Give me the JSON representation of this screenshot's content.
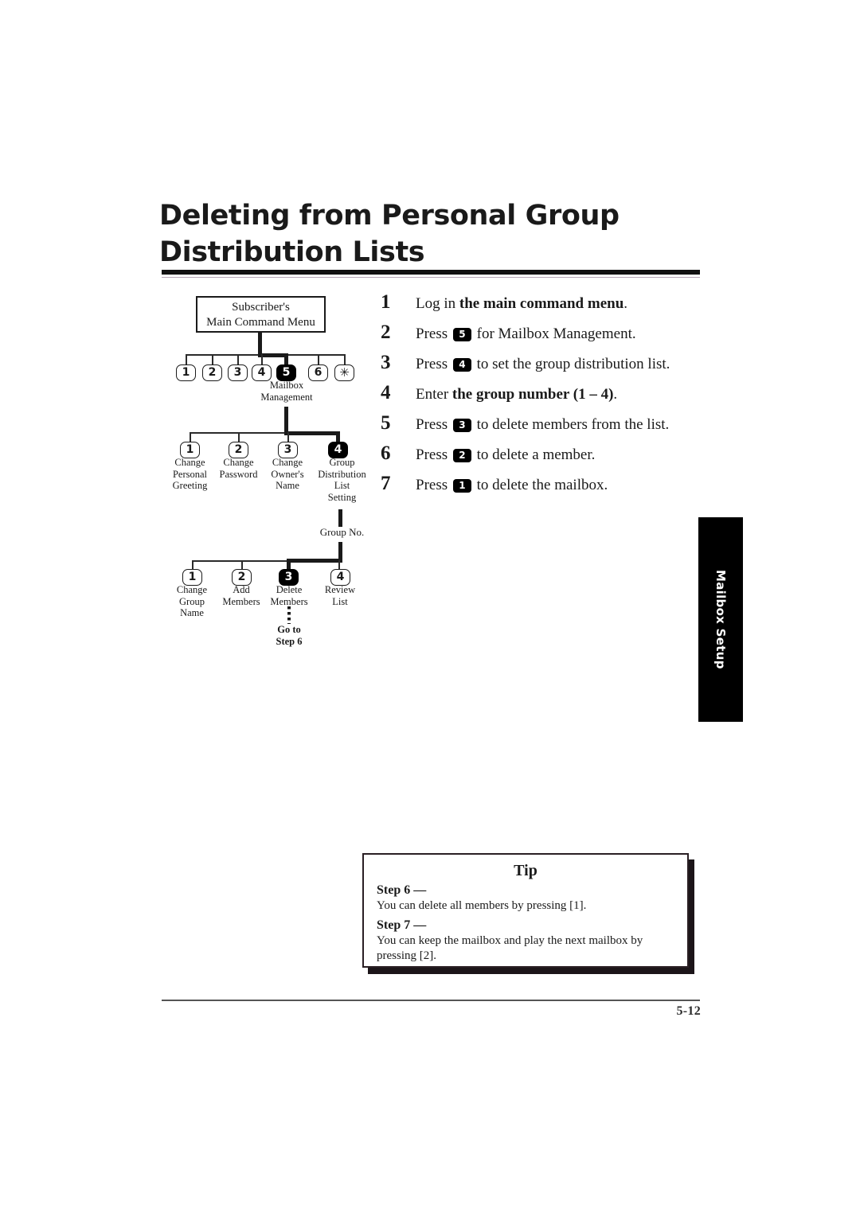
{
  "page": {
    "title": "Deleting from Personal Group Distribution Lists",
    "number": "5-12",
    "side_tab": "Mailbox Setup"
  },
  "diagram": {
    "root_box": "Subscriber's\nMain Command Menu",
    "root_box_line1": "Subscriber's",
    "root_box_line2": "Main Command Menu",
    "level1": {
      "keys": [
        {
          "label": "1",
          "selected": false
        },
        {
          "label": "2",
          "selected": false
        },
        {
          "label": "3",
          "selected": false
        },
        {
          "label": "4",
          "selected": false
        },
        {
          "label": "5",
          "selected": true
        },
        {
          "label": "6",
          "selected": false
        },
        {
          "label": "✳",
          "selected": false
        }
      ],
      "selected_caption": "Mailbox\nManagement",
      "selected_caption_line1": "Mailbox",
      "selected_caption_line2": "Management"
    },
    "level2": {
      "nodes": [
        {
          "key": "1",
          "selected": false,
          "caption": "Change\nPersonal\nGreeting"
        },
        {
          "key": "2",
          "selected": false,
          "caption": "Change\nPassword"
        },
        {
          "key": "3",
          "selected": false,
          "caption": "Change\nOwner's\nName"
        },
        {
          "key": "4",
          "selected": true,
          "caption": "Group\nDistribution\nList\nSetting"
        }
      ]
    },
    "connector_label": "Group No.",
    "level3": {
      "nodes": [
        {
          "key": "1",
          "selected": false,
          "caption": "Change\nGroup\nName"
        },
        {
          "key": "2",
          "selected": false,
          "caption": "Add\nMembers"
        },
        {
          "key": "3",
          "selected": true,
          "caption": "Delete\nMembers"
        },
        {
          "key": "4",
          "selected": false,
          "caption": "Review\nList"
        }
      ]
    },
    "goto_label": "Go to\nStep 6",
    "goto_line1": "Go to",
    "goto_line2": "Step 6"
  },
  "steps": [
    {
      "number": "1",
      "pre": "Log in ",
      "bold": "the main command menu",
      "key": "",
      "post": "."
    },
    {
      "number": "2",
      "pre": "Press ",
      "bold": "",
      "key": "5",
      "post": " for Mailbox Management."
    },
    {
      "number": "3",
      "pre": "Press ",
      "bold": "",
      "key": "4",
      "post": " to set the group distribution list."
    },
    {
      "number": "4",
      "pre": "Enter ",
      "bold": "the group number (1 – 4)",
      "key": "",
      "post": "."
    },
    {
      "number": "5",
      "pre": "Press ",
      "bold": "",
      "key": "3",
      "post": " to delete members from the list."
    },
    {
      "number": "6",
      "pre": "Press ",
      "bold": "",
      "key": "2",
      "post": " to delete a member."
    },
    {
      "number": "7",
      "pre": "Press ",
      "bold": "",
      "key": "1",
      "post": " to delete the mailbox."
    }
  ],
  "tip": {
    "title": "Tip",
    "entries": [
      {
        "heading": "Step 6 —",
        "body": "You can delete all members by pressing [1]."
      },
      {
        "heading": "Step 7 —",
        "body": "You can keep the mailbox and play the next mailbox by pressing [2]."
      }
    ]
  }
}
